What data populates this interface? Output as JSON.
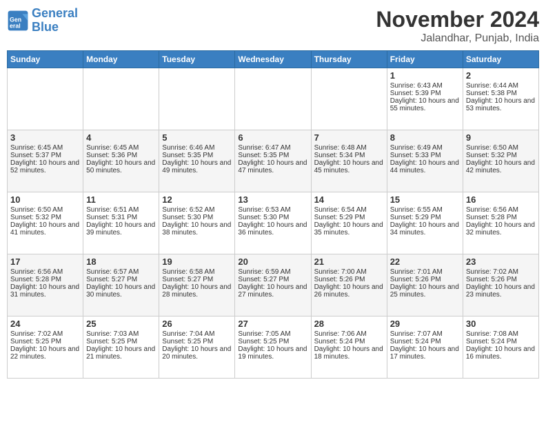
{
  "header": {
    "logo_line1": "General",
    "logo_line2": "Blue",
    "month_title": "November 2024",
    "location": "Jalandhar, Punjab, India"
  },
  "weekdays": [
    "Sunday",
    "Monday",
    "Tuesday",
    "Wednesday",
    "Thursday",
    "Friday",
    "Saturday"
  ],
  "weeks": [
    [
      {
        "day": "",
        "info": ""
      },
      {
        "day": "",
        "info": ""
      },
      {
        "day": "",
        "info": ""
      },
      {
        "day": "",
        "info": ""
      },
      {
        "day": "",
        "info": ""
      },
      {
        "day": "1",
        "info": "Sunrise: 6:43 AM\nSunset: 5:39 PM\nDaylight: 10 hours and 55 minutes."
      },
      {
        "day": "2",
        "info": "Sunrise: 6:44 AM\nSunset: 5:38 PM\nDaylight: 10 hours and 53 minutes."
      }
    ],
    [
      {
        "day": "3",
        "info": "Sunrise: 6:45 AM\nSunset: 5:37 PM\nDaylight: 10 hours and 52 minutes."
      },
      {
        "day": "4",
        "info": "Sunrise: 6:45 AM\nSunset: 5:36 PM\nDaylight: 10 hours and 50 minutes."
      },
      {
        "day": "5",
        "info": "Sunrise: 6:46 AM\nSunset: 5:35 PM\nDaylight: 10 hours and 49 minutes."
      },
      {
        "day": "6",
        "info": "Sunrise: 6:47 AM\nSunset: 5:35 PM\nDaylight: 10 hours and 47 minutes."
      },
      {
        "day": "7",
        "info": "Sunrise: 6:48 AM\nSunset: 5:34 PM\nDaylight: 10 hours and 45 minutes."
      },
      {
        "day": "8",
        "info": "Sunrise: 6:49 AM\nSunset: 5:33 PM\nDaylight: 10 hours and 44 minutes."
      },
      {
        "day": "9",
        "info": "Sunrise: 6:50 AM\nSunset: 5:32 PM\nDaylight: 10 hours and 42 minutes."
      }
    ],
    [
      {
        "day": "10",
        "info": "Sunrise: 6:50 AM\nSunset: 5:32 PM\nDaylight: 10 hours and 41 minutes."
      },
      {
        "day": "11",
        "info": "Sunrise: 6:51 AM\nSunset: 5:31 PM\nDaylight: 10 hours and 39 minutes."
      },
      {
        "day": "12",
        "info": "Sunrise: 6:52 AM\nSunset: 5:30 PM\nDaylight: 10 hours and 38 minutes."
      },
      {
        "day": "13",
        "info": "Sunrise: 6:53 AM\nSunset: 5:30 PM\nDaylight: 10 hours and 36 minutes."
      },
      {
        "day": "14",
        "info": "Sunrise: 6:54 AM\nSunset: 5:29 PM\nDaylight: 10 hours and 35 minutes."
      },
      {
        "day": "15",
        "info": "Sunrise: 6:55 AM\nSunset: 5:29 PM\nDaylight: 10 hours and 34 minutes."
      },
      {
        "day": "16",
        "info": "Sunrise: 6:56 AM\nSunset: 5:28 PM\nDaylight: 10 hours and 32 minutes."
      }
    ],
    [
      {
        "day": "17",
        "info": "Sunrise: 6:56 AM\nSunset: 5:28 PM\nDaylight: 10 hours and 31 minutes."
      },
      {
        "day": "18",
        "info": "Sunrise: 6:57 AM\nSunset: 5:27 PM\nDaylight: 10 hours and 30 minutes."
      },
      {
        "day": "19",
        "info": "Sunrise: 6:58 AM\nSunset: 5:27 PM\nDaylight: 10 hours and 28 minutes."
      },
      {
        "day": "20",
        "info": "Sunrise: 6:59 AM\nSunset: 5:27 PM\nDaylight: 10 hours and 27 minutes."
      },
      {
        "day": "21",
        "info": "Sunrise: 7:00 AM\nSunset: 5:26 PM\nDaylight: 10 hours and 26 minutes."
      },
      {
        "day": "22",
        "info": "Sunrise: 7:01 AM\nSunset: 5:26 PM\nDaylight: 10 hours and 25 minutes."
      },
      {
        "day": "23",
        "info": "Sunrise: 7:02 AM\nSunset: 5:26 PM\nDaylight: 10 hours and 23 minutes."
      }
    ],
    [
      {
        "day": "24",
        "info": "Sunrise: 7:02 AM\nSunset: 5:25 PM\nDaylight: 10 hours and 22 minutes."
      },
      {
        "day": "25",
        "info": "Sunrise: 7:03 AM\nSunset: 5:25 PM\nDaylight: 10 hours and 21 minutes."
      },
      {
        "day": "26",
        "info": "Sunrise: 7:04 AM\nSunset: 5:25 PM\nDaylight: 10 hours and 20 minutes."
      },
      {
        "day": "27",
        "info": "Sunrise: 7:05 AM\nSunset: 5:25 PM\nDaylight: 10 hours and 19 minutes."
      },
      {
        "day": "28",
        "info": "Sunrise: 7:06 AM\nSunset: 5:24 PM\nDaylight: 10 hours and 18 minutes."
      },
      {
        "day": "29",
        "info": "Sunrise: 7:07 AM\nSunset: 5:24 PM\nDaylight: 10 hours and 17 minutes."
      },
      {
        "day": "30",
        "info": "Sunrise: 7:08 AM\nSunset: 5:24 PM\nDaylight: 10 hours and 16 minutes."
      }
    ]
  ]
}
